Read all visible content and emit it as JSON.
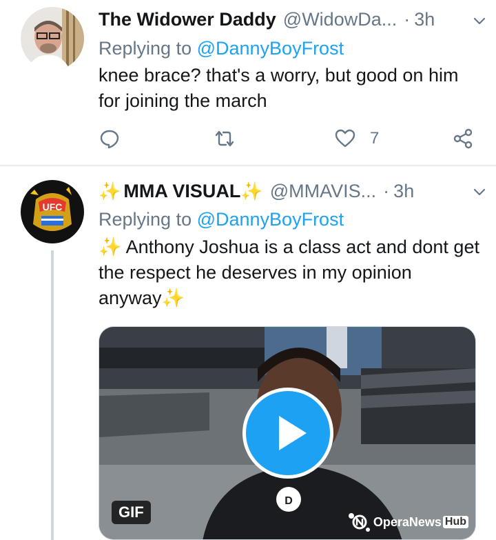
{
  "tweets": [
    {
      "name": "The Widower Daddy",
      "handle": "@WidowDa...",
      "dot": "·",
      "time": "3h",
      "replying_label": "Replying to ",
      "replying_to": "@DannyBoyFrost",
      "text": "knee brace? that's a worry, but good on him for joining the march",
      "actions": {
        "like_count": "7"
      }
    },
    {
      "name_prefix": "✨",
      "name": "MMA VISUAL",
      "name_suffix": "✨",
      "handle": "@MMAVIS...",
      "dot": "·",
      "time": "3h",
      "replying_label": "Replying to ",
      "replying_to": "@DannyBoyFrost",
      "text": "✨ Anthony Joshua is a class act and dont get the respect he deserves in my opinion anyway✨",
      "media": {
        "badge": "GIF",
        "watermark": "OperaNews",
        "watermark_hub": "Hub"
      }
    }
  ],
  "colors": {
    "accent": "#1da1f2",
    "secondary_text": "#657786",
    "divider": "#e6ecf0"
  }
}
